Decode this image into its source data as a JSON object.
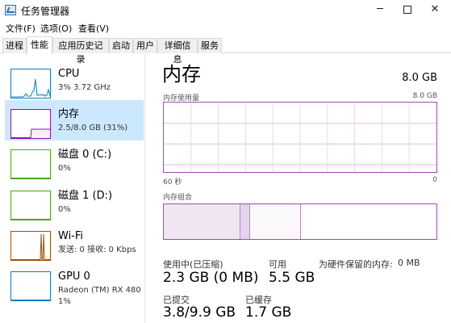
{
  "window": {
    "title": "任务管理器"
  },
  "menu": [
    "文件(F)",
    "选项(O)",
    "查看(V)"
  ],
  "tabs": [
    {
      "label": "进程",
      "active": false
    },
    {
      "label": "性能",
      "active": true
    },
    {
      "label": "应用历史记录",
      "active": false
    },
    {
      "label": "启动",
      "active": false
    },
    {
      "label": "用户",
      "active": false
    },
    {
      "label": "详细信息",
      "active": false
    },
    {
      "label": "服务",
      "active": false
    }
  ],
  "sidebar": {
    "items": [
      {
        "name": "CPU",
        "sub1": "3% 3.72 GHz",
        "sub2": "",
        "color": "#117dbb",
        "selected": false
      },
      {
        "name": "内存",
        "sub1": "2.5/8.0 GB (31%)",
        "sub2": "",
        "color": "#8b12ae",
        "selected": true
      },
      {
        "name": "磁盘 0 (C:)",
        "sub1": "0%",
        "sub2": "",
        "color": "#4da60c",
        "selected": false
      },
      {
        "name": "磁盘 1 (D:)",
        "sub1": "0%",
        "sub2": "",
        "color": "#4da60c",
        "selected": false
      },
      {
        "name": "Wi-Fi",
        "sub1": "发送: 0 接收: 0 Kbps",
        "sub2": "",
        "color": "#a74f01",
        "selected": false
      },
      {
        "name": "GPU 0",
        "sub1": "Radeon (TM) RX 480",
        "sub2": "1%",
        "color": "#117dbb",
        "selected": false
      }
    ]
  },
  "main": {
    "title": "内存",
    "total": "8.0 GB",
    "usage_label": "内存使用量",
    "usage_max": "8.0 GB",
    "time_span": "60 秒",
    "min_value": "0",
    "composition_label": "内存组合",
    "composition": {
      "in_use": 0.28,
      "modified": 0.035,
      "standby": 0.185
    },
    "stats": {
      "in_use_label": "使用中(已压缩)",
      "in_use_value": "2.3 GB (0 MB)",
      "available_label": "可用",
      "available_value": "5.5 GB",
      "reserved_label": "为硬件保留的内存:",
      "reserved_value": "0 MB",
      "committed_label": "已提交",
      "committed_value": "3.8/9.9 GB",
      "cached_label": "已缓存",
      "cached_value": "1.7 GB"
    }
  },
  "colors": {
    "memory": "#8b12ae",
    "selected_bg": "#cce8ff"
  }
}
